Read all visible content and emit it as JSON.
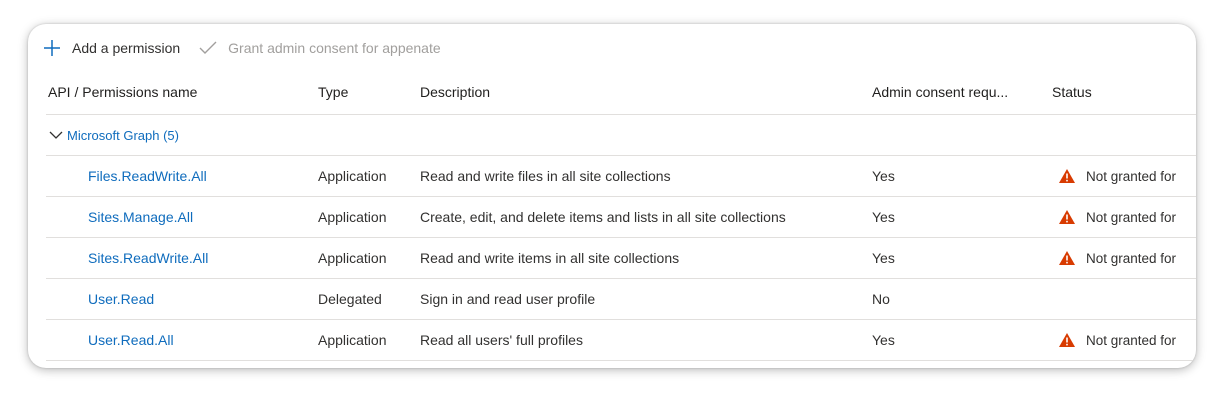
{
  "toolbar": {
    "add_label": "Add a permission",
    "grant_label": "Grant admin consent for appenate"
  },
  "columns": {
    "name": "API / Permissions name",
    "type": "Type",
    "description": "Description",
    "admin": "Admin consent requ...",
    "status": "Status"
  },
  "group": {
    "label": "Microsoft Graph (5)"
  },
  "rows": [
    {
      "name": "Files.ReadWrite.All",
      "type": "Application",
      "description": "Read and write files in all site collections",
      "admin": "Yes",
      "status": "Not granted for"
    },
    {
      "name": "Sites.Manage.All",
      "type": "Application",
      "description": "Create, edit, and delete items and lists in all site collections",
      "admin": "Yes",
      "status": "Not granted for"
    },
    {
      "name": "Sites.ReadWrite.All",
      "type": "Application",
      "description": "Read and write items in all site collections",
      "admin": "Yes",
      "status": "Not granted for"
    },
    {
      "name": "User.Read",
      "type": "Delegated",
      "description": "Sign in and read user profile",
      "admin": "No",
      "status": ""
    },
    {
      "name": "User.Read.All",
      "type": "Application",
      "description": "Read all users' full profiles",
      "admin": "Yes",
      "status": "Not granted for"
    }
  ],
  "icons": {
    "add": "plus-icon",
    "grant": "checkmark-icon",
    "group_toggle": "chevron-down-icon",
    "status_warning": "warning-icon"
  },
  "colors": {
    "link": "#0f6cbd",
    "warning": "#d83b01",
    "disabled": "#a19f9d",
    "border": "#e1dfdd"
  }
}
